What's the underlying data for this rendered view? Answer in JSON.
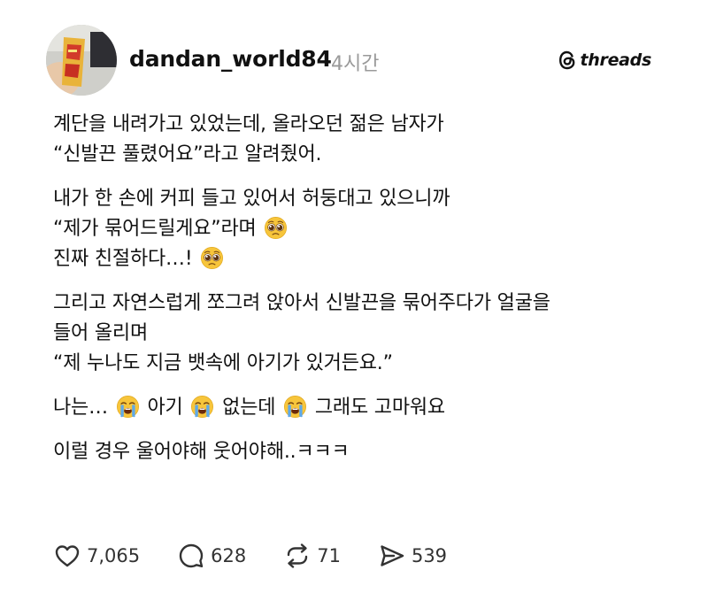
{
  "header": {
    "username": "dandan_world84",
    "time": "4시간",
    "brand": "threads"
  },
  "paragraphs": [
    {
      "lines": [
        {
          "segments": [
            {
              "text": "계단을 내려가고 있었는데, 올라오던 젊은 남자가"
            }
          ]
        },
        {
          "segments": [
            {
              "text": "“신발끈 풀렸어요”라고 알려줬어."
            }
          ]
        }
      ]
    },
    {
      "lines": [
        {
          "segments": [
            {
              "text": "내가 한 손에 커피 들고 있어서 허둥대고 있으니까"
            }
          ]
        },
        {
          "segments": [
            {
              "text": "“제가 묶어드릴게요”라며 "
            },
            {
              "emoji": "pleading-face-emoji"
            }
          ]
        },
        {
          "segments": [
            {
              "text": "진짜 친절하다…! "
            },
            {
              "emoji": "pleading-face-emoji"
            }
          ]
        }
      ]
    },
    {
      "lines": [
        {
          "segments": [
            {
              "text": "그리고 자연스럽게 쪼그려 앉아서 신발끈을 묶어주다가 얼굴을"
            }
          ]
        },
        {
          "segments": [
            {
              "text": "들어 올리며"
            }
          ]
        },
        {
          "segments": [
            {
              "text": "“제 누나도 지금 뱃속에 아기가 있거든요.”"
            }
          ]
        }
      ]
    },
    {
      "lines": [
        {
          "segments": [
            {
              "text": "나는… "
            },
            {
              "emoji": "loudly-crying-face-emoji"
            },
            {
              "text": " 아기 "
            },
            {
              "emoji": "loudly-crying-face-emoji"
            },
            {
              "text": " 없는데 "
            },
            {
              "emoji": "loudly-crying-face-emoji"
            },
            {
              "text": " 그래도 고마워요"
            }
          ]
        }
      ]
    },
    {
      "lines": [
        {
          "segments": [
            {
              "text": "이럴 경우 울어야해 웃어야해..ㅋㅋㅋ"
            }
          ]
        }
      ]
    }
  ],
  "actions": {
    "likes": "7,065",
    "replies": "628",
    "reposts": "71",
    "shares": "539"
  },
  "icons": {
    "like": "heart-icon",
    "reply": "comment-bubble-icon",
    "repost": "repost-arrows-icon",
    "share": "send-icon",
    "brand": "threads-logo-icon"
  },
  "colors": {
    "text": "#111111",
    "muted": "#9a9a9a",
    "background": "#ffffff"
  }
}
